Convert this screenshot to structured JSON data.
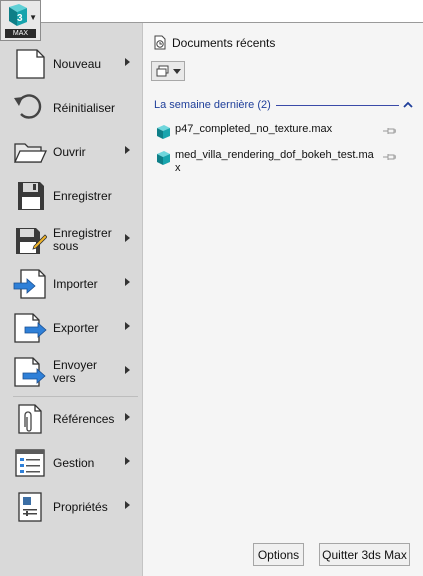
{
  "app": {
    "badge": "MAX",
    "logo_icon": "3ds-max-logo-icon",
    "dropdown_icon": "chevron-down-icon"
  },
  "menu": {
    "items": [
      {
        "label": "Nouveau",
        "icon": "new-document-icon",
        "has_submenu": true
      },
      {
        "label": "Réinitialiser",
        "icon": "reset-icon",
        "has_submenu": false
      },
      {
        "label": "Ouvrir",
        "icon": "open-folder-icon",
        "has_submenu": true
      },
      {
        "label": "Enregistrer",
        "icon": "save-disk-icon",
        "has_submenu": false
      },
      {
        "label": "Enregistrer sous",
        "icon": "save-as-icon",
        "has_submenu": true
      },
      {
        "label": "Importer",
        "icon": "import-icon",
        "has_submenu": true
      },
      {
        "label": "Exporter",
        "icon": "export-icon",
        "has_submenu": true
      },
      {
        "label": "Envoyer vers",
        "icon": "send-to-icon",
        "has_submenu": true
      },
      {
        "label": "Références",
        "icon": "references-icon",
        "has_submenu": true
      },
      {
        "label": "Gestion",
        "icon": "manage-icon",
        "has_submenu": true
      },
      {
        "label": "Propriétés",
        "icon": "properties-icon",
        "has_submenu": true
      }
    ]
  },
  "recent": {
    "title": "Documents récents",
    "title_icon": "recent-documents-icon",
    "view_icon": "view-options-icon",
    "group": {
      "label": "La semaine dernière (2)",
      "collapse_icon": "chevron-up-icon",
      "files": [
        {
          "name": "p47_completed_no_texture.max",
          "icon": "max-file-icon",
          "pin_icon": "pin-icon"
        },
        {
          "name": "med_villa_rendering_dof_bokeh_test.max",
          "icon": "max-file-icon",
          "pin_icon": "pin-icon"
        }
      ]
    }
  },
  "footer": {
    "options_label": "Options",
    "quit_label": "Quitter 3ds Max"
  },
  "colors": {
    "menu_bg": "#d9d9d9",
    "pane_bg": "#f5f5f5",
    "group_header": "#1f3f9a",
    "accent_blue": "#2f80d8",
    "logo_teal": "#1aa0a8"
  }
}
